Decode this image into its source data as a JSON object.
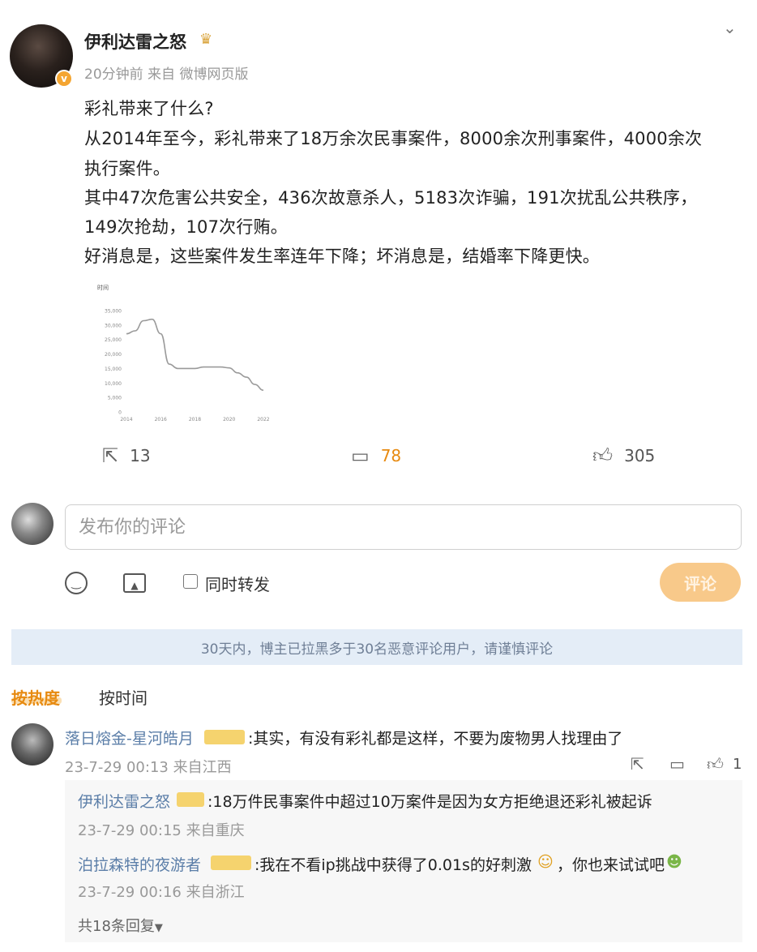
{
  "post": {
    "author": "伊利达雷之怒",
    "verified_mark": "v",
    "crown_icon": "crown-icon",
    "meta": "20分钟前  来自  微博网页版",
    "lines": [
      "彩礼带来了什么?",
      "从2014年至今，彩礼带来了18万余次民事案件，8000余次刑事案件，4000余次",
      "执行案件。",
      "其中47次危害公共安全，436次故意杀人，5183次诈骗，191次扰乱公共秩序，",
      "149次抢劫，107次行贿。",
      "好消息是，这些案件发生率连年下降；坏消息是，结婚率下降更快。"
    ]
  },
  "chart_data": {
    "type": "line",
    "title": "",
    "ylabel": "时间",
    "xlabel": "",
    "y_ticks": [
      "35,000",
      "30,000",
      "25,000",
      "20,000",
      "15,000",
      "10,000",
      "5,000",
      "0"
    ],
    "x_ticks": [
      "2014",
      "2016",
      "2018",
      "2020",
      "2022"
    ],
    "ylim": [
      0,
      35000
    ],
    "xlim": [
      2014,
      2022
    ],
    "grid": false,
    "series": [
      {
        "x": [
          2014,
          2014.5,
          2015,
          2015.5,
          2016,
          2016.5,
          2017,
          2017.5,
          2018,
          2018.5,
          2019,
          2019.5,
          2020,
          2020.5,
          2021,
          2021.5,
          2022
        ],
        "values": [
          27000,
          28000,
          31500,
          32000,
          27000,
          16500,
          15000,
          15000,
          15000,
          15500,
          15500,
          15500,
          15200,
          13500,
          12000,
          9500,
          7500
        ]
      }
    ]
  },
  "actions": {
    "share_icon": "share-icon",
    "share_count": "13",
    "comment_icon": "comment-icon",
    "comment_count": "78",
    "like_icon": "like-icon",
    "like_count": "305"
  },
  "compose": {
    "placeholder": "发布你的评论",
    "forward_label": "同时转发",
    "submit_label": "评论"
  },
  "notice": "30天内，博主已拉黑多于30名恶意评论用户，请谨慎评论",
  "sort": {
    "hot": "按热度",
    "time": "按时间"
  },
  "comments": [
    {
      "user": "落日熔金-星河皓月",
      "text": ":其实，有没有彩礼都是这样，不要为废物男人找理由了",
      "meta": "23-7-29 00:13  来自江西",
      "like_count": "1",
      "replies": [
        {
          "user": "伊利达雷之怒",
          "text": ":18万件民事案件中超过10万案件是因为女方拒绝退还彩礼被起诉",
          "meta": "23-7-29 00:15  来自重庆"
        },
        {
          "user": "泊拉森特的夜游者",
          "text": ":我在不看ip挑战中获得了0.01s的好刺激",
          "text_tail": "，你也来试试吧",
          "meta": "23-7-29 00:16  来自浙江"
        }
      ],
      "reply_count": "共18条回复"
    }
  ],
  "colors": {
    "accent": "#e78a10",
    "link": "#5b7ea8",
    "notice_bg": "#e4edf7",
    "submit_bg": "#f8c98a"
  }
}
